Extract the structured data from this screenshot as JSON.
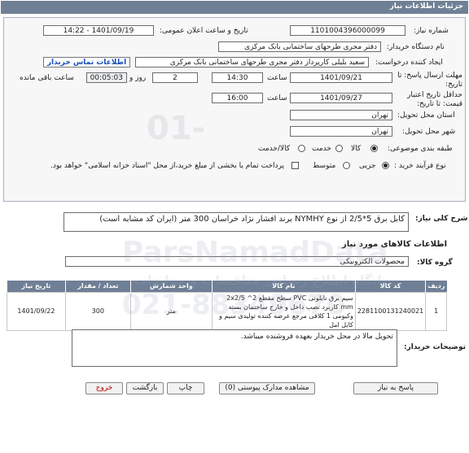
{
  "header": {
    "title": "جزئیات اطلاعات نیاز"
  },
  "fields": {
    "need_number_label": "شماره نیاز:",
    "need_number": "1101004396000099",
    "announce_label": "تاریخ و ساعت اعلان عمومی:",
    "announce_value": "1401/09/19 - 14:22",
    "buyer_org_label": "نام دستگاه خریدار:",
    "buyer_org": "دفتر مجری طرحهای ساختمانی بانک مرکزی",
    "creator_label": "ایجاد کننده درخواست:",
    "creator": "سعید بلیلی کارپرداز دفتر مجری طرحهای ساختمانی بانک مرکزی",
    "contact_link": "اطلاعات تماس خریدار",
    "deadline_label": "مهلت ارسال پاسخ: تا تاریخ:",
    "deadline_date": "1401/09/21",
    "time_label": "ساعت",
    "deadline_time": "14:30",
    "days_value": "2",
    "days_label": "روز و",
    "remaining": "00:05:03",
    "remaining_label": "ساعت باقی مانده",
    "validity_label": "حداقل تاریخ اعتبار قیمت: تا تاریخ:",
    "validity_date": "1401/09/27",
    "validity_time": "16:00",
    "province_label": "استان محل تحویل:",
    "province": "تهران",
    "city_label": "شهر محل تحویل:",
    "city": "تهران",
    "category_label": "طبقه بندی موضوعی:",
    "category_options": [
      "کالا",
      "خدمت",
      "کالا/خدمت"
    ],
    "process_label": "نوع فرآیند خرید :",
    "process_options": [
      "جزیی",
      "متوسط"
    ],
    "payment_note": "پرداخت تمام یا بخشی از مبلغ خرید،از محل \"اسناد خزانه اسلامی\" خواهد بود."
  },
  "summary": {
    "label": "شرح کلی نیاز:",
    "value": "کابل برق 5*2/5 از نوع NYMHY برند افشار نژاد خراسان 300 متر (ایران کد مشابه است)"
  },
  "goods_info_title": "اطلاعات کالاهای مورد نیاز",
  "goods_group": {
    "label": "گروه کالا:",
    "value": "محصولات الکترونیکی"
  },
  "table": {
    "headers": [
      "ردیف",
      "کد کالا",
      "نام کالا",
      "واحد شمارش",
      "تعداد / مقدار",
      "تاریخ نیاز"
    ],
    "rows": [
      {
        "row": "1",
        "code": "2281100131240021",
        "name": "سیم برق نایلونی PVC سطح مقطع 2^ 2x2/5 mm کاربرد نصب داخل و خارج ساختمان بسته وکیومی 1 کلافی مرجع عرضه کننده تولیدی سیم و کابل امل",
        "unit": "متر",
        "qty": "300",
        "date": "1401/09/22"
      }
    ]
  },
  "buyer_notes": {
    "label": "توضیحات خریدار:",
    "value": "تحویل مالا در محل خریدار بعهده فروشنده میباشد."
  },
  "buttons": {
    "reply": "پاسخ به نیاز",
    "docs": "مشاهده مدارک پیوستی (0)",
    "print": "چاپ",
    "back": "بازگشت",
    "exit": "خروج"
  },
  "watermark": {
    "text1": "ParsNamadData",
    "text2": "021-88349670",
    "text3": "پایگاه اطلاع رسانی مناقصات و مزایدات"
  }
}
